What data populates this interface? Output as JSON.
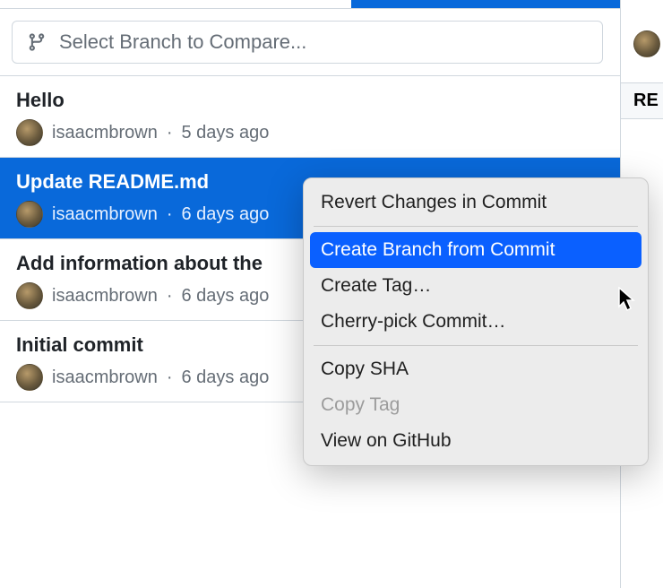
{
  "branchSelector": {
    "placeholder": "Select Branch to Compare..."
  },
  "rightPanel": {
    "tabLabel": "RE"
  },
  "commits": [
    {
      "title": "Hello",
      "author": "isaacmbrown",
      "time": "5 days ago"
    },
    {
      "title": "Update README.md",
      "author": "isaacmbrown",
      "time": "6 days ago"
    },
    {
      "title": "Add information about the",
      "author": "isaacmbrown",
      "time": "6 days ago"
    },
    {
      "title": "Initial commit",
      "author": "isaacmbrown",
      "time": "6 days ago"
    }
  ],
  "selectedCommitIndex": 1,
  "contextMenu": {
    "items": [
      {
        "label": "Revert Changes in Commit",
        "type": "item",
        "enabled": true
      },
      {
        "type": "sep"
      },
      {
        "label": "Create Branch from Commit",
        "type": "item",
        "enabled": true,
        "highlighted": true
      },
      {
        "label": "Create Tag…",
        "type": "item",
        "enabled": true
      },
      {
        "label": "Cherry-pick Commit…",
        "type": "item",
        "enabled": true
      },
      {
        "type": "sep"
      },
      {
        "label": "Copy SHA",
        "type": "item",
        "enabled": true
      },
      {
        "label": "Copy Tag",
        "type": "item",
        "enabled": false
      },
      {
        "label": "View on GitHub",
        "type": "item",
        "enabled": true
      }
    ]
  },
  "sep": "·"
}
